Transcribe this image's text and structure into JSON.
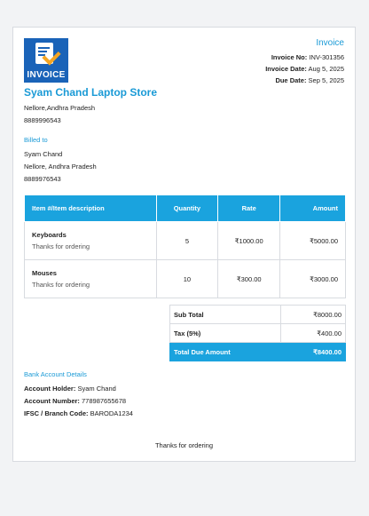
{
  "invoice": {
    "title": "Invoice",
    "no_label": "Invoice No:",
    "no": "INV-301356",
    "date_label": "Invoice Date:",
    "date": "Aug 5, 2025",
    "due_label": "Due Date:",
    "due": "Sep 5, 2025"
  },
  "logo": {
    "word": "INVOICE"
  },
  "store": {
    "name": "Syam Chand Laptop Store",
    "address": "Nellore,Andhra Pradesh",
    "phone": "8889996543"
  },
  "billed": {
    "heading": "Billed to",
    "name": "Syam Chand",
    "address": "Nellore, Andhra Pradesh",
    "phone": "8889976543"
  },
  "table": {
    "headers": [
      "Item #/Item description",
      "Quantity",
      "Rate",
      "Amount"
    ],
    "rows": [
      {
        "item": "Keyboards",
        "note": "Thanks for ordering",
        "qty": "5",
        "rate": "₹1000.00",
        "amount": "₹5000.00"
      },
      {
        "item": "Mouses",
        "note": "Thanks for ordering",
        "qty": "10",
        "rate": "₹300.00",
        "amount": "₹3000.00"
      }
    ]
  },
  "totals": {
    "subtotal_label": "Sub Total",
    "subtotal": "₹8000.00",
    "tax_label": "Tax (5%)",
    "tax": "₹400.00",
    "due_label": "Total Due Amount",
    "due": "₹8400.00"
  },
  "bank": {
    "heading": "Bank Account Details",
    "holder_label": "Account Holder:",
    "holder": "Syam Chand",
    "number_label": "Account Number:",
    "number": "778987655678",
    "ifsc_label": "IFSC / Branch Code:",
    "ifsc": "BARODA1234"
  },
  "footer": "Thanks for ordering",
  "colors": {
    "accent": "#1aa3de",
    "logo_bg": "#1a63b8",
    "check": "#f6a623"
  }
}
